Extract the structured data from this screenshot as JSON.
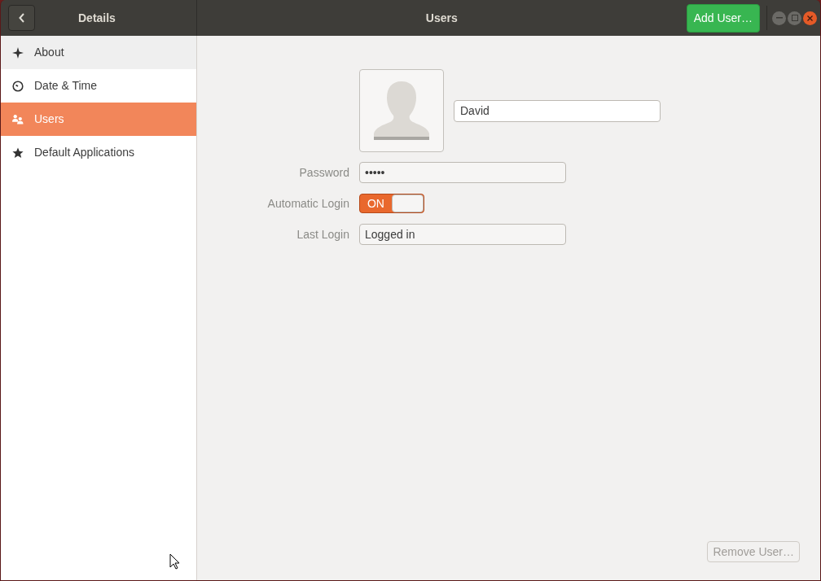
{
  "sidebar": {
    "title": "Details",
    "items": [
      {
        "label": "About",
        "kind": "about",
        "selected": false,
        "hovered": true
      },
      {
        "label": "Date & Time",
        "kind": "clock",
        "selected": false,
        "hovered": false
      },
      {
        "label": "Users",
        "kind": "users",
        "selected": true,
        "hovered": false
      },
      {
        "label": "Default Applications",
        "kind": "star",
        "selected": false,
        "hovered": false
      }
    ]
  },
  "window": {
    "title": "Users",
    "add_button": "Add User…"
  },
  "user": {
    "name": "David",
    "fields": [
      {
        "label": "Password",
        "kind": "field",
        "value": "•••••"
      },
      {
        "label": "Automatic Login",
        "kind": "switch",
        "on": true,
        "on_text": "ON"
      },
      {
        "label": "Last Login",
        "kind": "field",
        "value": "Logged in"
      }
    ]
  },
  "remove_button": {
    "label": "Remove User…",
    "disabled": true
  }
}
